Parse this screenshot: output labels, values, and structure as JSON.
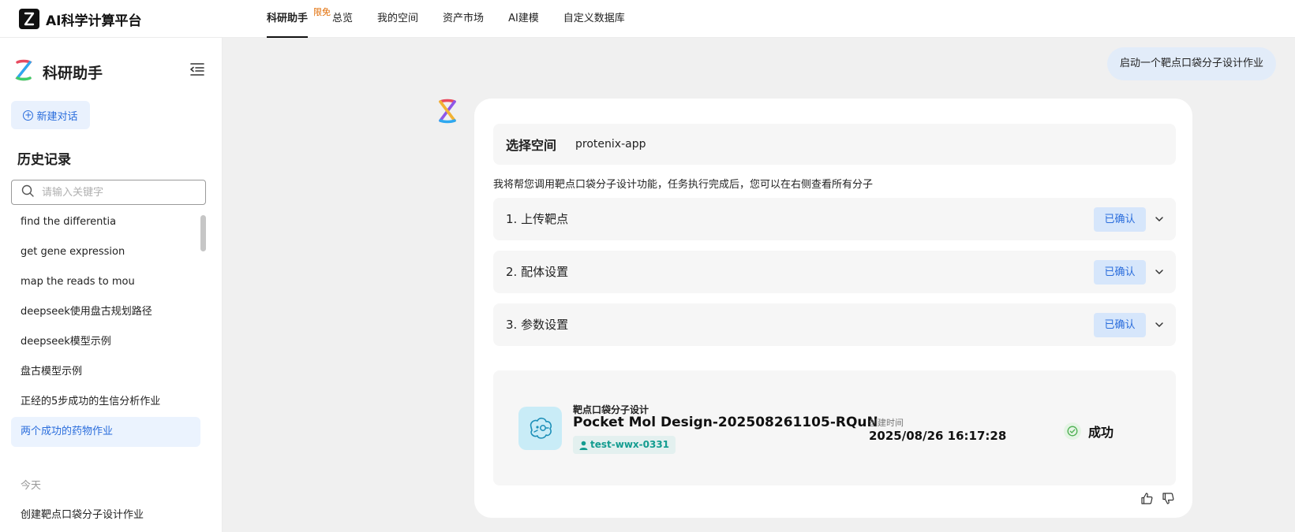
{
  "app": {
    "title": "AI科学计算平台"
  },
  "nav": {
    "items": [
      {
        "label": "科研助手",
        "active": true
      },
      {
        "label": "总览"
      },
      {
        "label": "我的空间"
      },
      {
        "label": "资产市场"
      },
      {
        "label": "AI建模"
      },
      {
        "label": "自定义数据库"
      }
    ],
    "badge": "限免"
  },
  "sidebar": {
    "title": "科研助手",
    "new_chat": "新建对话",
    "history_title": "历史记录",
    "search_placeholder": "请输入关键字",
    "history": [
      {
        "label": "find the differentia"
      },
      {
        "label": "get gene expression"
      },
      {
        "label": "map the reads to mou"
      },
      {
        "label": "deepseek使用盘古规划路径"
      },
      {
        "label": "deepseek模型示例"
      },
      {
        "label": "盘古模型示例"
      },
      {
        "label": "正经的5步成功的生信分析作业"
      },
      {
        "label": "两个成功的药物作业",
        "active": true
      }
    ],
    "group_today": "今天",
    "today": [
      {
        "label": "创建靶点口袋分子设计作业"
      }
    ]
  },
  "chat": {
    "user_message": "启动一个靶点口袋分子设计作业",
    "space_label": "选择空间",
    "space_value": "protenix-app",
    "description": "我将帮您调用靶点口袋分子设计功能，任务执行完成后，您可以在右侧查看所有分子",
    "steps": [
      {
        "label": "1. 上传靶点",
        "status": "已确认"
      },
      {
        "label": "2. 配体设置",
        "status": "已确认"
      },
      {
        "label": "3. 参数设置",
        "status": "已确认"
      }
    ],
    "job": {
      "kind": "靶点口袋分子设计",
      "name": "Pocket Mol Design-202508261105-RQuN",
      "user": "test-wwx-0331",
      "created_label": "创建时间",
      "created_time": "2025/08/26 16:17:28",
      "status": "成功"
    }
  },
  "colors": {
    "accent": "#2a6ddc",
    "success": "#4caf50",
    "teal": "#139c90"
  },
  "icons": [
    "app-logo-icon",
    "assistant-logo-icon",
    "collapse-sidebar-icon",
    "plus-circle-icon",
    "search-icon",
    "chevron-down-icon",
    "molecule-icon",
    "user-icon",
    "check-circle-icon",
    "thumbs-up-icon",
    "thumbs-down-icon"
  ]
}
